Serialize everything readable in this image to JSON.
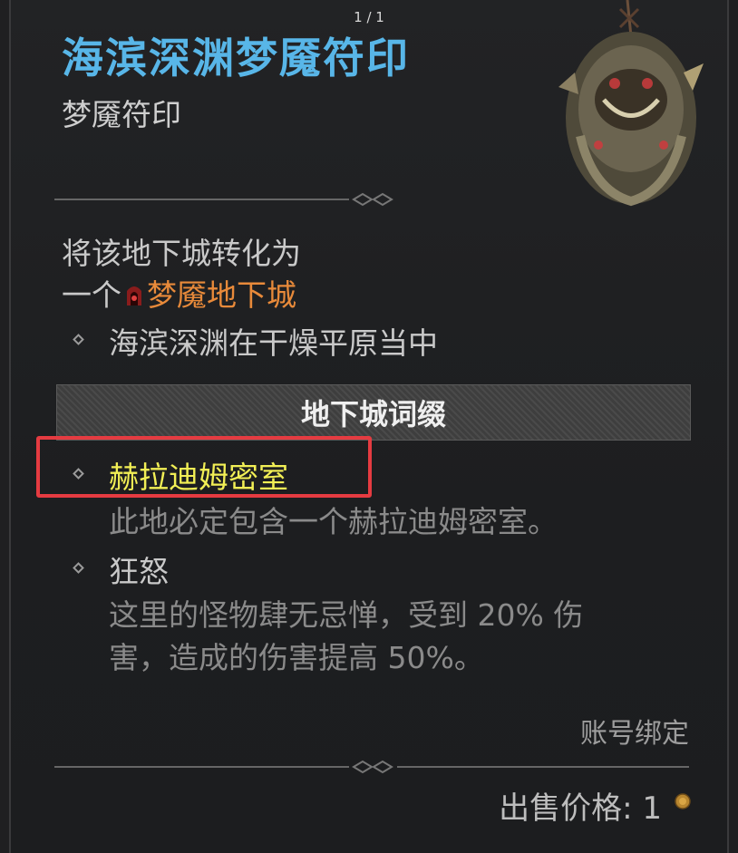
{
  "viewer": {
    "counter": "1 / 1"
  },
  "item": {
    "name": "海滨深渊梦魇符印",
    "type": "梦魇符印",
    "effect_line1": "将该地下城转化为",
    "effect_line2_prefix": "一个",
    "effect_line2_highlight": "梦魇地下城",
    "location": "海滨深渊在干燥平原当中",
    "affix_section_title": "地下城词缀",
    "affixes": [
      {
        "name": "赫拉迪姆密室",
        "description": "此地必定包含一个赫拉迪姆密室。"
      },
      {
        "name": "狂怒",
        "description_line1": "这里的怪物肆无忌惮，受到 20% 伤",
        "description_line2": "害，造成的伤害提高 50%。"
      }
    ],
    "binding": "账号绑定",
    "price_label": "出售价格:",
    "price_value": "1"
  },
  "colors": {
    "title": "#58b6e8",
    "nightmare": "#e88a3a",
    "affix_highlight": "#f2ef55",
    "annotation_box": "#e53b41"
  },
  "icons": [
    "nightmare-dungeon-icon",
    "diamond-bullet-icon",
    "gold-coin-icon",
    "sigil-item-image"
  ]
}
